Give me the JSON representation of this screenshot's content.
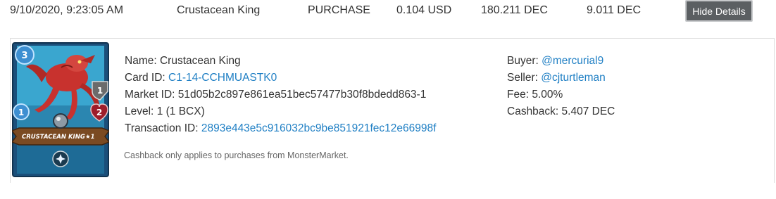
{
  "summary_row": {
    "datetime": "9/10/2020, 9:23:05 AM",
    "card_name": "Crustacean King",
    "type": "PURCHASE",
    "price_usd": "0.104 USD",
    "price_dec": "180.211 DEC",
    "fee_dec": "9.011 DEC",
    "hide_details_label": "Hide Details"
  },
  "details": {
    "name_label": "Name:",
    "name_value": "Crustacean King",
    "card_id_label": "Card ID:",
    "card_id_value": "C1-14-CCHMUASTK0",
    "market_id_label": "Market ID:",
    "market_id_value": "51d05b2c897e861ea51bec57477b30f8bdedd863-1",
    "level_label": "Level:",
    "level_value": "1 (1 BCX)",
    "transaction_id_label": "Transaction ID:",
    "transaction_id_value": "2893e443e5c916032bc9be851921fec12e66998f",
    "buyer_label": "Buyer:",
    "buyer_value": "@mercurial9",
    "seller_label": "Seller:",
    "seller_value": "@cjturtleman",
    "fee_label": "Fee:",
    "fee_value": "5.00%",
    "cashback_label": "Cashback:",
    "cashback_value": "5.407 DEC",
    "cashback_note": "Cashback only applies to purchases from MonsterMarket."
  },
  "card": {
    "mana": "3",
    "speed": "1",
    "armor": "1",
    "health": "2",
    "title": "CRUSTACEAN KING",
    "level_badge": "★1",
    "ability_icon": "sparkle-icon",
    "colors": {
      "frame": "#1b4f7a",
      "background": "#3aa6cf",
      "creature": "#c8322e",
      "banner": "#7a4a22"
    }
  },
  "colors": {
    "link": "#1f7fc4",
    "button_bg": "#5b5f62",
    "text": "#333333"
  }
}
